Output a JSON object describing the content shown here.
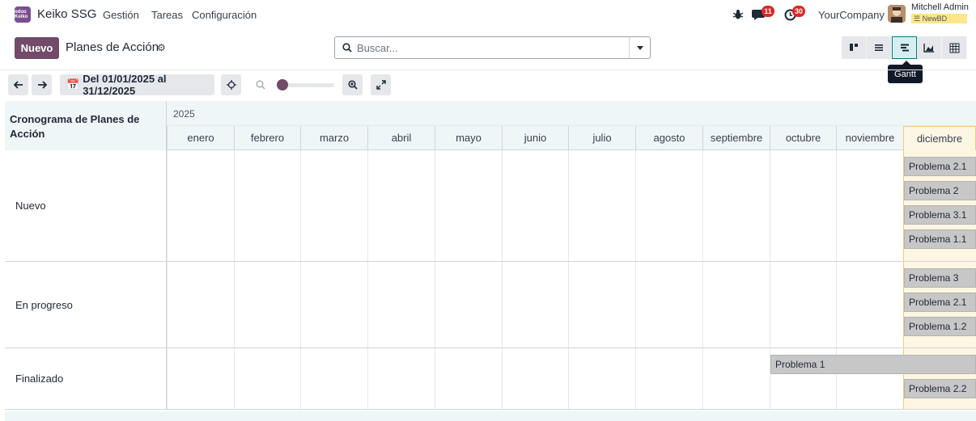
{
  "navbar": {
    "app_name": "Keiko SSG",
    "logo_text": "odoo Keiko",
    "menu": [
      "Gestión",
      "Tareas",
      "Configuración"
    ],
    "messages_count": "11",
    "activities_count": "30",
    "company": "YourCompany",
    "user_name": "Mitchell Admin",
    "database": "NewBD"
  },
  "control_panel": {
    "new_label": "Nuevo",
    "title": "Planes de Acción",
    "search_placeholder": "Buscar...",
    "views": [
      "kanban-view-icon",
      "list-view-icon",
      "gantt-view-icon",
      "graph-view-icon",
      "pivot-view-icon"
    ],
    "active_view": "Gantt",
    "tooltip": "Gantt"
  },
  "gantt_toolbar": {
    "date_range": "Del 01/01/2025 al 31/12/2025",
    "zoom_level": 0
  },
  "gantt": {
    "header_title": "Cronograma de Planes de Acción",
    "year": "2025",
    "months": [
      "enero",
      "febrero",
      "marzo",
      "abril",
      "mayo",
      "junio",
      "julio",
      "agosto",
      "septiembre",
      "octubre",
      "noviembre",
      "diciembre"
    ],
    "today_month": "diciembre",
    "rows": [
      {
        "label": "Nuevo",
        "pills": [
          {
            "name": "Problema 2.1",
            "start": "diciembre",
            "end": "diciembre"
          },
          {
            "name": "Problema 2",
            "start": "diciembre",
            "end": "diciembre"
          },
          {
            "name": "Problema 3.1",
            "start": "diciembre",
            "end": "diciembre"
          },
          {
            "name": "Problema 1.1",
            "start": "diciembre",
            "end": "diciembre"
          }
        ]
      },
      {
        "label": "En progreso",
        "pills": [
          {
            "name": "Problema 3",
            "start": "diciembre",
            "end": "diciembre"
          },
          {
            "name": "Problema 2.1",
            "start": "diciembre",
            "end": "diciembre"
          },
          {
            "name": "Problema 1.2",
            "start": "diciembre",
            "end": "diciembre"
          }
        ]
      },
      {
        "label": "Finalizado",
        "pills": [
          {
            "name": "Problema 1",
            "start": "octubre",
            "end": "diciembre"
          },
          {
            "name": "Problema 2.2",
            "start": "diciembre",
            "end": "diciembre"
          }
        ]
      }
    ]
  }
}
